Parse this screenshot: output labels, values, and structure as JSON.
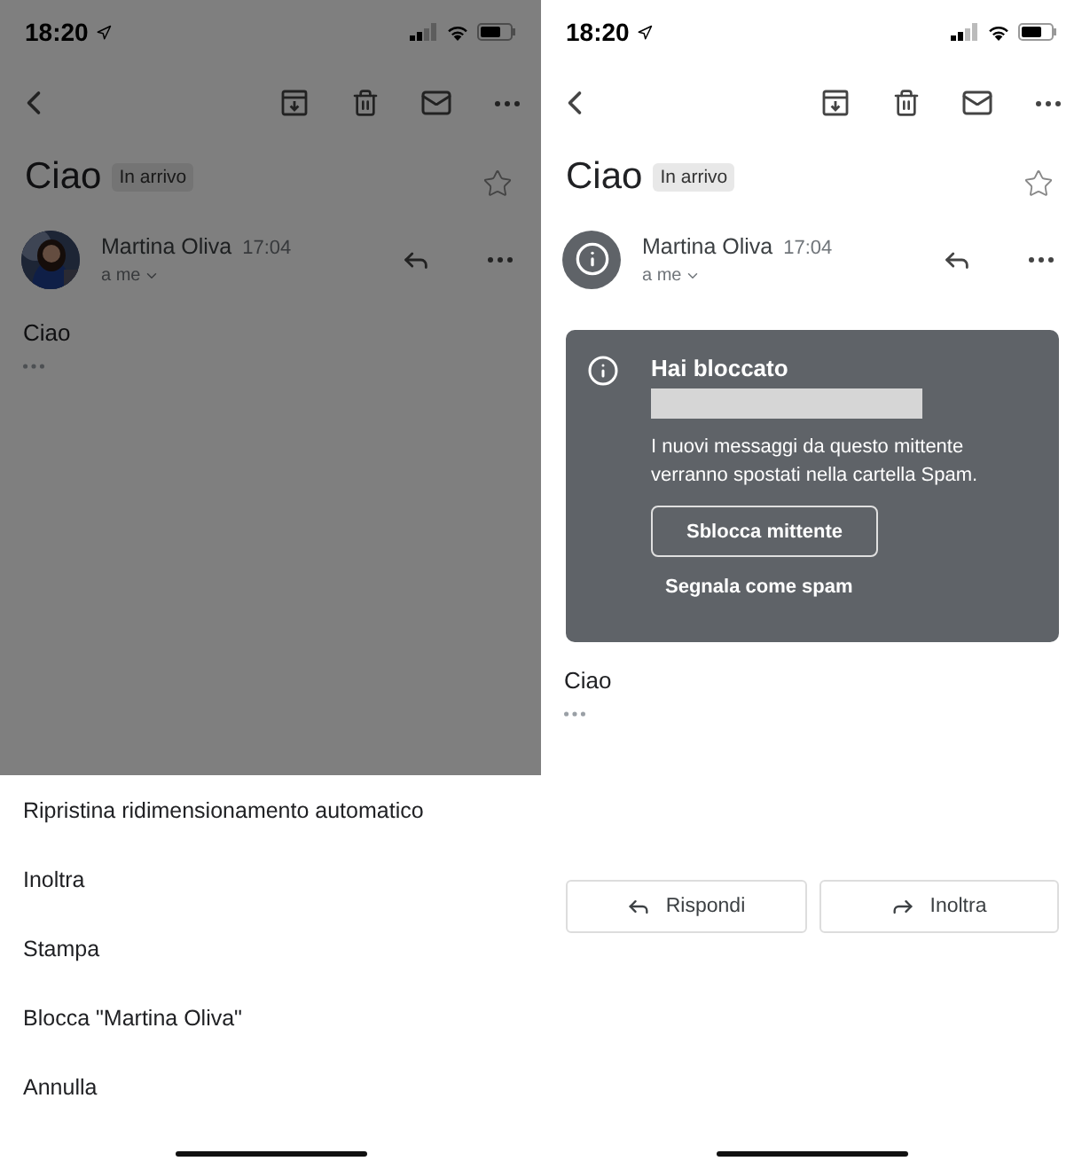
{
  "screens": [
    {
      "kind": "sheet",
      "status_bar": {
        "time": "18:20"
      },
      "subject": "Ciao",
      "label": "In arrivo",
      "sender": {
        "name": "Martina Oliva",
        "time": "17:04",
        "recipient": "a me"
      },
      "body": "Ciao",
      "action_sheet": [
        "Ripristina ridimensionamento automatico",
        "Inoltra",
        "Stampa",
        "Blocca \"Martina Oliva\"",
        "Annulla"
      ]
    },
    {
      "kind": "blocked",
      "status_bar": {
        "time": "18:20"
      },
      "subject": "Ciao",
      "label": "In arrivo",
      "sender": {
        "name": "Martina Oliva",
        "time": "17:04",
        "recipient": "a me",
        "avatar": {
          "kind": "info"
        }
      },
      "banner": {
        "title": "Hai bloccato",
        "message": "I nuovi messaggi da questo mittente verranno spostati nella cartella Spam.",
        "primary": "Sblocca mittente",
        "secondary": "Segnala come spam"
      },
      "body": "Ciao",
      "buttons": [
        {
          "kind": "reply",
          "label": "Rispondi"
        },
        {
          "kind": "forward",
          "label": "Inoltra"
        }
      ]
    }
  ]
}
